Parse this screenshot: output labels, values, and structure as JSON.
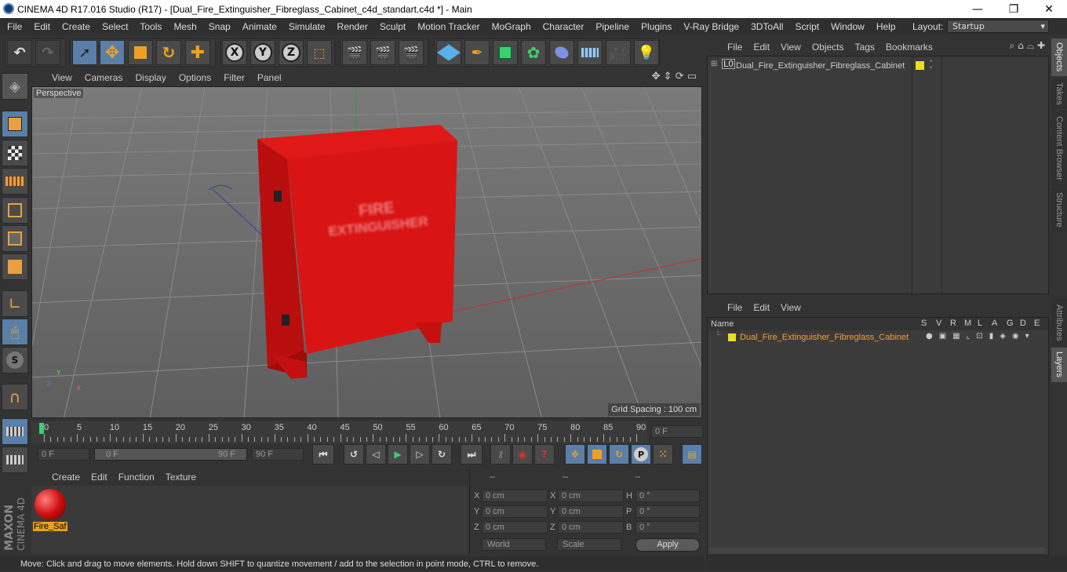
{
  "window": {
    "title": "CINEMA 4D R17.016 Studio (R17) - [Dual_Fire_Extinguisher_Fibreglass_Cabinet_c4d_standart.c4d *] - Main",
    "minimize": "—",
    "maximize": "❐",
    "close": "✕"
  },
  "menu": [
    "File",
    "Edit",
    "Create",
    "Select",
    "Tools",
    "Mesh",
    "Snap",
    "Animate",
    "Simulate",
    "Render",
    "Sculpt",
    "Motion Tracker",
    "MoGraph",
    "Character",
    "Pipeline",
    "Plugins",
    "V-Ray Bridge",
    "3DToAll",
    "Script",
    "Window",
    "Help"
  ],
  "layout": {
    "label": "Layout:",
    "value": "Startup"
  },
  "toolbar": {
    "x": "X",
    "y": "Y",
    "z": "Z"
  },
  "viewport": {
    "menu": [
      "View",
      "Cameras",
      "Display",
      "Options",
      "Filter",
      "Panel"
    ],
    "label": "Perspective",
    "grid_spacing": "Grid Spacing : 100 cm",
    "cabinet_text_1": "FIRE",
    "cabinet_text_2": "EXTINGUISHER",
    "axis_y": "Y",
    "axis_x": "X",
    "axis_z": "Z"
  },
  "timeline": {
    "ticks": [
      "0",
      "5",
      "10",
      "15",
      "20",
      "25",
      "30",
      "35",
      "40",
      "45",
      "50",
      "55",
      "60",
      "65",
      "70",
      "75",
      "80",
      "85",
      "90"
    ],
    "current_frame": "0 F",
    "start": "0 F",
    "range_start": "0 F",
    "range_end": "90 F",
    "end": "90 F"
  },
  "materials": {
    "menu": [
      "Create",
      "Edit",
      "Function",
      "Texture"
    ],
    "item": "Fire_Saf"
  },
  "coords": {
    "headers": [
      "--",
      "--",
      "--"
    ],
    "rows": [
      {
        "a": "X",
        "av": "0 cm",
        "b": "X",
        "bv": "0 cm",
        "c": "H",
        "cv": "0 °"
      },
      {
        "a": "Y",
        "av": "0 cm",
        "b": "Y",
        "bv": "0 cm",
        "c": "P",
        "cv": "0 °"
      },
      {
        "a": "Z",
        "av": "0 cm",
        "b": "Z",
        "bv": "0 cm",
        "c": "B",
        "cv": "0 °"
      }
    ],
    "world": "World",
    "scale": "Scale",
    "apply": "Apply"
  },
  "objects": {
    "menu": [
      "File",
      "Edit",
      "View",
      "Objects",
      "Tags",
      "Bookmarks"
    ],
    "item": "Dual_Fire_Extinguisher_Fibreglass_Cabinet"
  },
  "layers": {
    "menu": [
      "File",
      "Edit",
      "View"
    ],
    "name_header": "Name",
    "cols": [
      "S",
      "V",
      "R",
      "M",
      "L",
      "A",
      "G",
      "D",
      "E"
    ],
    "item": "Dual_Fire_Extinguisher_Fibreglass_Cabinet"
  },
  "right_tabs": [
    "Objects",
    "Takes",
    "Content Browser",
    "Structure"
  ],
  "right_tabs2": [
    "Attributes",
    "Layers"
  ],
  "status": "Move: Click and drag to move elements. Hold down SHIFT to quantize movement / add to the selection in point mode, CTRL to remove.",
  "brand": {
    "maxon": "MAXON",
    "c4d": "CINEMA 4D"
  },
  "colors": {
    "accent": "#e8a020",
    "red": "#d61010",
    "active": "#5a7fa8"
  }
}
